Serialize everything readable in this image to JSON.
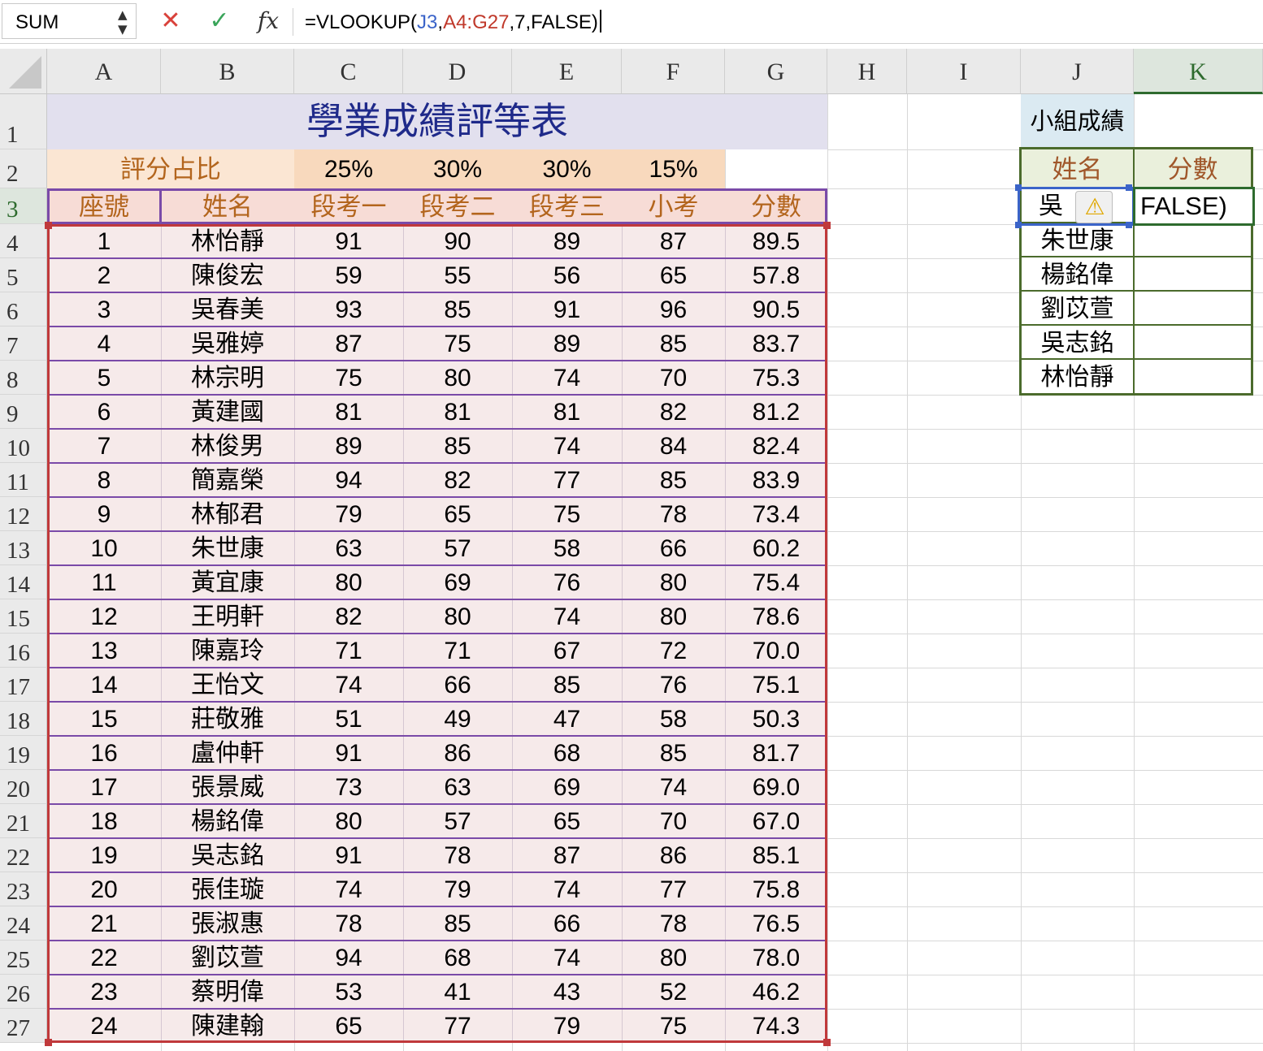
{
  "formula_bar": {
    "name_box": "SUM",
    "name_box_arrows": "▲▼",
    "cancel_icon": "✕",
    "enter_icon": "✓",
    "fx_label": "fx",
    "formula_prefix": "=VLOOKUP(",
    "formula_ref1": "J3",
    "formula_comma1": ",",
    "formula_ref2": "A4:G27",
    "formula_suffix": ",7,FALSE)"
  },
  "columns": [
    "A",
    "B",
    "C",
    "D",
    "E",
    "F",
    "G",
    "H",
    "I",
    "J",
    "K"
  ],
  "selected_column": "K",
  "rows": [
    "1",
    "2",
    "3",
    "4",
    "5",
    "6",
    "7",
    "8",
    "9",
    "10",
    "11",
    "12",
    "13",
    "14",
    "15",
    "16",
    "17",
    "18",
    "19",
    "20",
    "21",
    "22",
    "23",
    "24",
    "25",
    "26",
    "27"
  ],
  "selected_row": "3",
  "sheet": {
    "title": "學業成績評等表",
    "weight_label": "評分占比",
    "weights": [
      "25%",
      "30%",
      "30%",
      "15%"
    ],
    "headers": [
      "座號",
      "姓名",
      "段考一",
      "段考二",
      "段考三",
      "小考",
      "分數"
    ],
    "records": [
      [
        "1",
        "林怡靜",
        "91",
        "90",
        "89",
        "87",
        "89.5"
      ],
      [
        "2",
        "陳俊宏",
        "59",
        "55",
        "56",
        "65",
        "57.8"
      ],
      [
        "3",
        "吳春美",
        "93",
        "85",
        "91",
        "96",
        "90.5"
      ],
      [
        "4",
        "吳雅婷",
        "87",
        "75",
        "89",
        "85",
        "83.7"
      ],
      [
        "5",
        "林宗明",
        "75",
        "80",
        "74",
        "70",
        "75.3"
      ],
      [
        "6",
        "黃建國",
        "81",
        "81",
        "81",
        "82",
        "81.2"
      ],
      [
        "7",
        "林俊男",
        "89",
        "85",
        "74",
        "84",
        "82.4"
      ],
      [
        "8",
        "簡嘉榮",
        "94",
        "82",
        "77",
        "85",
        "83.9"
      ],
      [
        "9",
        "林郁君",
        "79",
        "65",
        "75",
        "78",
        "73.4"
      ],
      [
        "10",
        "朱世康",
        "63",
        "57",
        "58",
        "66",
        "60.2"
      ],
      [
        "11",
        "黃宜康",
        "80",
        "69",
        "76",
        "80",
        "75.4"
      ],
      [
        "12",
        "王明軒",
        "82",
        "80",
        "74",
        "80",
        "78.6"
      ],
      [
        "13",
        "陳嘉玲",
        "71",
        "71",
        "67",
        "72",
        "70.0"
      ],
      [
        "14",
        "王怡文",
        "74",
        "66",
        "85",
        "76",
        "75.1"
      ],
      [
        "15",
        "莊敬雅",
        "51",
        "49",
        "47",
        "58",
        "50.3"
      ],
      [
        "16",
        "盧仲軒",
        "91",
        "86",
        "68",
        "85",
        "81.7"
      ],
      [
        "17",
        "張景威",
        "73",
        "63",
        "69",
        "74",
        "69.0"
      ],
      [
        "18",
        "楊銘偉",
        "80",
        "57",
        "65",
        "70",
        "67.0"
      ],
      [
        "19",
        "吳志銘",
        "91",
        "78",
        "87",
        "86",
        "85.1"
      ],
      [
        "20",
        "張佳璇",
        "74",
        "79",
        "74",
        "77",
        "75.8"
      ],
      [
        "21",
        "張淑惠",
        "78",
        "85",
        "66",
        "78",
        "76.5"
      ],
      [
        "22",
        "劉苡萱",
        "94",
        "68",
        "74",
        "80",
        "78.0"
      ],
      [
        "23",
        "蔡明偉",
        "53",
        "41",
        "43",
        "52",
        "46.2"
      ],
      [
        "24",
        "陳建翰",
        "65",
        "77",
        "79",
        "75",
        "74.3"
      ]
    ]
  },
  "group": {
    "title": "小組成績",
    "headers": [
      "姓名",
      "分數"
    ],
    "names": [
      "吳雅婷",
      "朱世康",
      "楊銘偉",
      "劉苡萱",
      "吳志銘",
      "林怡靜"
    ],
    "first_name_visible": "吳",
    "editing_cell_text": "FALSE)",
    "warning_icon": "⚠"
  }
}
